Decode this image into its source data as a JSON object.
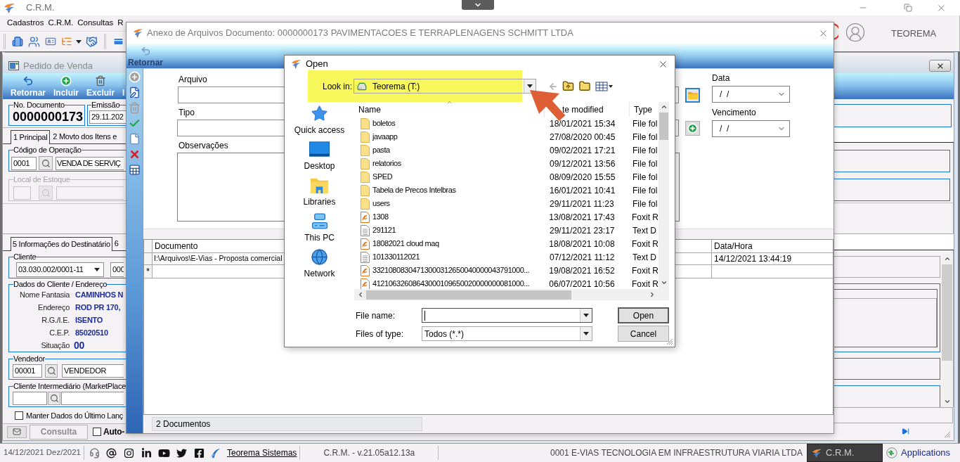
{
  "app_window": {
    "title": "C.R.M."
  },
  "menu_bar": {
    "items": [
      "Cadastros",
      "C.R.M.",
      "Consultas",
      "R"
    ]
  },
  "user": {
    "name": "TEOREMA"
  },
  "sales_order_window": {
    "title": "Pedido de Venda",
    "toolbar": [
      "Retornar",
      "Incluir",
      "Excluir",
      "I"
    ],
    "document_number": {
      "label": "No. Documento",
      "value": "0000000173"
    },
    "issue_date": {
      "label": "Emissão",
      "value": "29.11.202"
    },
    "tabs": [
      {
        "label": "1 Principal",
        "selected": true
      },
      {
        "label": "2 Movto dos Itens e",
        "selected": false
      }
    ],
    "operation": {
      "label": "Código de Operação",
      "code": "0001",
      "description": "VENDA DE SERVIÇ"
    },
    "stock_location": {
      "label": "Local de Estoque",
      "disabled": true
    },
    "lower_tabs": [
      {
        "label": "5 Informações do Destinatário",
        "selected": true
      },
      {
        "label": "6",
        "selected": false
      }
    ],
    "customer": {
      "label": "Cliente",
      "document": "03.030.002/0001-11",
      "code": "000"
    },
    "customer_data": {
      "label": "Dados do Cliente / Endereço",
      "rows": [
        {
          "label": "Nome Fantasia",
          "value": "CAMINHOS N",
          "kind": "text"
        },
        {
          "label": "Endereço",
          "value": "ROD PR 170,",
          "kind": "text"
        },
        {
          "label": "R.G./I.E.",
          "value": "ISENTO",
          "kind": "text"
        },
        {
          "label": "C.E.P.",
          "value": "85020510",
          "kind": "text"
        },
        {
          "label": "Situação",
          "value": "00",
          "kind": "code"
        }
      ]
    },
    "seller": {
      "label": "Vendedor",
      "code": "00001",
      "name": "VENDEDOR"
    },
    "intermediary": {
      "label": "Cliente Intermediário (MarketPlace"
    },
    "keep_data": {
      "label": "Manter Dados do Último Lanç",
      "checked": false
    },
    "bottom_bar": {
      "tab": "Consulta",
      "auto": {
        "label": "Auto-",
        "checked": false
      }
    }
  },
  "attachments_dialog": {
    "title": "Anexo de Arquivos Documento: 0000000173 PAVIMENTACOES E TERRAPLENAGENS SCHMITT LTDA",
    "toolbar": [
      {
        "label": "Retornar",
        "disabled": true
      }
    ],
    "form": {
      "file_label": "Arquivo",
      "type_label": "Tipo",
      "notes_label": "Observações",
      "date": {
        "label": "Data",
        "value": "/  /"
      },
      "due_date": {
        "label": "Vencimento",
        "value": "/  /"
      }
    },
    "grid": {
      "columns": [
        "Documento",
        "Data/Hora"
      ],
      "rows": [
        {
          "document": "I:\\Arquivos\\E-Vias - Proposta comercial",
          "date_time": "14/12/2021 13:44:19"
        }
      ],
      "new_row_marker": "*"
    },
    "status": "2 Documentos"
  },
  "open_dialog": {
    "title": "Open",
    "look_in": {
      "label": "Look in:",
      "value": "Teorema (T:)",
      "highlighted": true
    },
    "places": [
      "Quick access",
      "Desktop",
      "Libraries",
      "This PC",
      "Network"
    ],
    "columns": [
      "Name",
      "te modified",
      "Type"
    ],
    "files": [
      {
        "name": "boletos",
        "date": "18/01/2021 15:34",
        "type": "File fol",
        "kind": "folder"
      },
      {
        "name": "javaapp",
        "date": "27/08/2020 00:45",
        "type": "File fol",
        "kind": "folder"
      },
      {
        "name": "pasta",
        "date": "09/02/2021 17:21",
        "type": "File fol",
        "kind": "folder"
      },
      {
        "name": "relatorios",
        "date": "09/12/2021 13:56",
        "type": "File fol",
        "kind": "folder"
      },
      {
        "name": "SPED",
        "date": "08/09/2020 15:55",
        "type": "File fol",
        "kind": "folder"
      },
      {
        "name": "Tabela de Precos Intelbras",
        "date": "16/01/2021 10:41",
        "type": "File fol",
        "kind": "folder"
      },
      {
        "name": "users",
        "date": "29/11/2021 11:23",
        "type": "File fol",
        "kind": "folder"
      },
      {
        "name": "1308",
        "date": "13/08/2021 17:43",
        "type": "Foxit R",
        "kind": "pdf"
      },
      {
        "name": "291121",
        "date": "29/11/2021 23:17",
        "type": "Text D",
        "kind": "text"
      },
      {
        "name": "18082021 cloud maq",
        "date": "18/08/2021 10:08",
        "type": "Foxit R",
        "kind": "pdf"
      },
      {
        "name": "101330112021",
        "date": "07/12/2021 11:12",
        "type": "Text D",
        "kind": "text"
      },
      {
        "name": "33210808304713000312650040000043791000...",
        "date": "19/08/2021 16:52",
        "type": "Foxit R",
        "kind": "pdf"
      },
      {
        "name": "41210632608643000109650020000000081000...",
        "date": "06/07/2021 10:56",
        "type": "Foxit R",
        "kind": "pdf"
      }
    ],
    "file_name": {
      "label": "File name:",
      "focused": true
    },
    "file_type": {
      "label": "Files of type:",
      "value": "Todos (*.*)"
    },
    "buttons": [
      {
        "label": "Open",
        "default": true
      },
      {
        "label": "Cancel",
        "default": false
      }
    ]
  },
  "status_bar": {
    "date": "14/12/2021 Dez/2021",
    "link": "Teorema Sistemas",
    "version": "C.R.M. - v.21.05a12.13a",
    "company": "0001 E-VIAS TECNOLOGIA EM INFRAESTRUTURA VIARIA LTDA"
  },
  "taskbar": [
    {
      "label": "C.R.M.",
      "selected": true
    },
    {
      "label": "Applications",
      "selected": false
    }
  ]
}
